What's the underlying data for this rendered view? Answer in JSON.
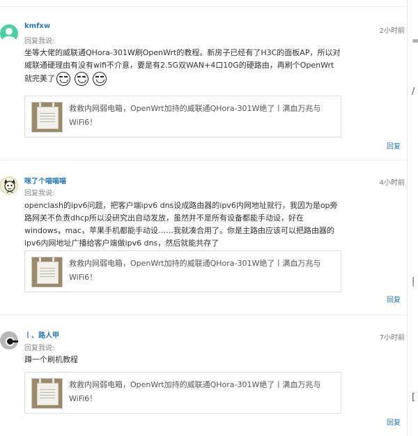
{
  "comments": [
    {
      "username": "kmfxw",
      "time": "2小时前",
      "reply_to": "回复我说:",
      "text": "坐等大佬的威联通QHora-301W刷OpenWrt的教程。新房子已经有了H3C的面板AP，所以对威联通硬理由有没有wifi不介意，要是有2.5G双WAN+4口10G的硬路由，再刷个OpenWrt就完美了",
      "card_title": "救救内网弱电箱，OpenWrt加持的威联通QHora-301W绝了丨满血万兆与WiFi6！",
      "reply_label": "回复"
    },
    {
      "username": "咪了个喵喵喵",
      "time": "4小时前",
      "reply_to": "回复我说:",
      "text": "openclash的ipv6问题，把客户端ipv6 dns设成路由器的ipv6内网地址就行，我因为是op旁路网关不负责dhcp所以没研究出自动发放，虽然并不是所有设备都能手动设，好在windows，mac，苹果手机都能手动设……我就凑合用了。你是主路由应该可以把路由器的ipv6内网地址广播给客户端做ipv6 dns，然后就能共存了",
      "card_title": "救救内网弱电箱，OpenWrt加持的威联通QHora-301W绝了丨满血万兆与WiFi6！",
      "reply_label": "回复"
    },
    {
      "username": "丨、路人甲",
      "time": "7小时前",
      "reply_to": "回复我说:",
      "text": "蹲一个刷机教程",
      "card_title": "救救内网弱电箱，OpenWrt加持的威联通QHora-301W绝了丨满血万兆与WiFi6！",
      "reply_label": "回复"
    }
  ],
  "edge_glyphs": [
    "=",
    "/",
    "|",
    "["
  ],
  "colors": {
    "link": "#2877b8",
    "avatar_green": "#4ccfa3"
  }
}
